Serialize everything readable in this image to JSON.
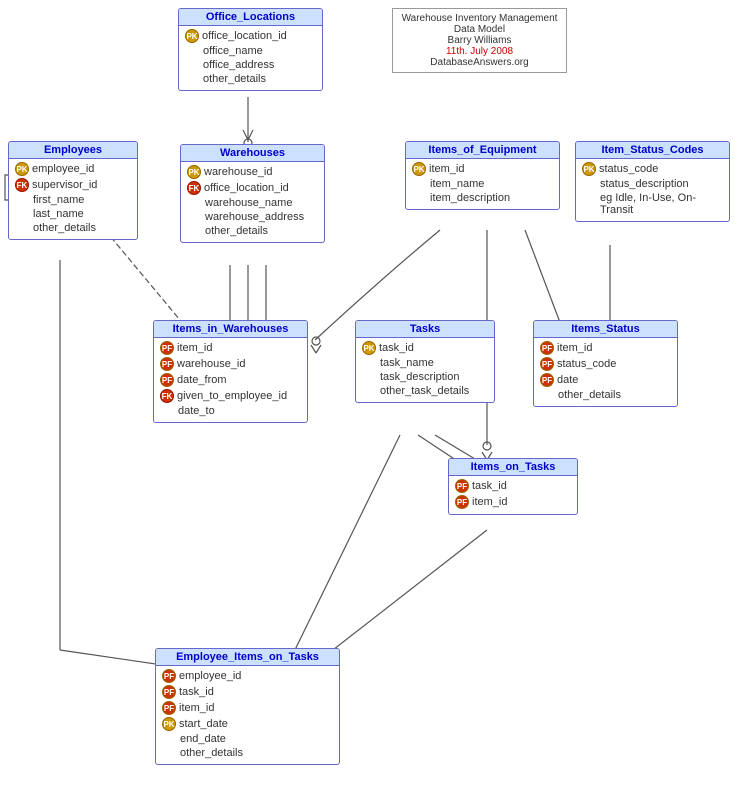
{
  "diagram": {
    "title": "Warehouse Inventory Management Data Model",
    "info": {
      "line1": "Warehouse Inventory Management",
      "line2": "Data Model",
      "line3": "Barry Williams",
      "line4": "11th. July 2008",
      "line5": "DatabaseAnswers.org"
    },
    "entities": {
      "office_locations": {
        "name": "Office_Locations",
        "fields": [
          {
            "key": "PK",
            "name": "office_location_id"
          },
          {
            "key": "",
            "name": "office_name"
          },
          {
            "key": "",
            "name": "office_address"
          },
          {
            "key": "",
            "name": "other_details"
          }
        ]
      },
      "employees": {
        "name": "Employees",
        "fields": [
          {
            "key": "PK",
            "name": "employee_id"
          },
          {
            "key": "FK",
            "name": "supervisor_id"
          },
          {
            "key": "",
            "name": "first_name"
          },
          {
            "key": "",
            "name": "last_name"
          },
          {
            "key": "",
            "name": "other_details"
          }
        ]
      },
      "warehouses": {
        "name": "Warehouses",
        "fields": [
          {
            "key": "PK",
            "name": "warehouse_id"
          },
          {
            "key": "FK",
            "name": "office_location_id"
          },
          {
            "key": "",
            "name": "warehouse_name"
          },
          {
            "key": "",
            "name": "warehouse_address"
          },
          {
            "key": "",
            "name": "other_details"
          }
        ]
      },
      "items_of_equipment": {
        "name": "Items_of_Equipment",
        "fields": [
          {
            "key": "PK",
            "name": "item_id"
          },
          {
            "key": "",
            "name": "item_name"
          },
          {
            "key": "",
            "name": "item_description"
          }
        ]
      },
      "item_status_codes": {
        "name": "Item_Status_Codes",
        "fields": [
          {
            "key": "PK",
            "name": "status_code"
          },
          {
            "key": "",
            "name": "status_description"
          },
          {
            "key": "",
            "name": "eg Idle, In-Use, On-Transit"
          }
        ]
      },
      "items_in_warehouses": {
        "name": "Items_in_Warehouses",
        "fields": [
          {
            "key": "PF",
            "name": "item_id"
          },
          {
            "key": "PF",
            "name": "warehouse_id"
          },
          {
            "key": "PF",
            "name": "date_from"
          },
          {
            "key": "FK",
            "name": "given_to_employee_id"
          },
          {
            "key": "",
            "name": "date_to"
          }
        ]
      },
      "tasks": {
        "name": "Tasks",
        "fields": [
          {
            "key": "PK",
            "name": "task_id"
          },
          {
            "key": "",
            "name": "task_name"
          },
          {
            "key": "",
            "name": "task_description"
          },
          {
            "key": "",
            "name": "other_task_details"
          }
        ]
      },
      "items_status": {
        "name": "Items_Status",
        "fields": [
          {
            "key": "PF",
            "name": "item_id"
          },
          {
            "key": "PF",
            "name": "status_code"
          },
          {
            "key": "PF",
            "name": "date"
          },
          {
            "key": "",
            "name": "other_details"
          }
        ]
      },
      "items_on_tasks": {
        "name": "Items_on_Tasks",
        "fields": [
          {
            "key": "PF",
            "name": "task_id"
          },
          {
            "key": "PF",
            "name": "item_id"
          }
        ]
      },
      "employee_items_on_tasks": {
        "name": "Employee_Items_on_Tasks",
        "fields": [
          {
            "key": "PF",
            "name": "employee_id"
          },
          {
            "key": "PF",
            "name": "task_id"
          },
          {
            "key": "PF",
            "name": "item_id"
          },
          {
            "key": "PK",
            "name": "start_date"
          },
          {
            "key": "",
            "name": "end_date"
          },
          {
            "key": "",
            "name": "other_details"
          }
        ]
      }
    },
    "labels": {
      "pk": "PK",
      "fk": "FK",
      "pf": "PF"
    }
  }
}
